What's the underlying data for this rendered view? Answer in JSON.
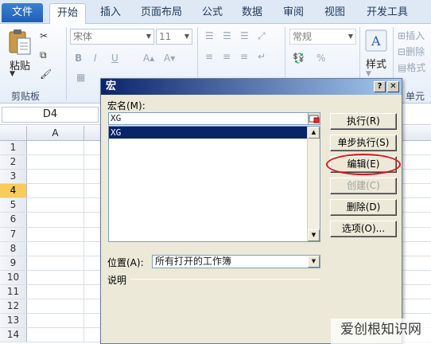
{
  "tabs": {
    "file": "文件",
    "items": [
      "开始",
      "插入",
      "页面布局",
      "公式",
      "数据",
      "审阅",
      "视图",
      "开发工具"
    ],
    "active_index": 0
  },
  "ribbon": {
    "paste_label": "粘贴",
    "clipboard_label": "剪贴板",
    "font_name": "宋体",
    "font_size": "11",
    "number_format": "常规",
    "style_label": "样式",
    "insert_label": "插入",
    "delete_label": "删除",
    "format_label": "格式",
    "cells_label": "单元格",
    "bold": "B",
    "italic": "I",
    "underline": "U"
  },
  "formula_bar": {
    "name_box": "D4"
  },
  "sheet": {
    "column_a": "A",
    "rows": [
      "1",
      "2",
      "3",
      "4",
      "5",
      "6",
      "7",
      "8",
      "9",
      "10",
      "11",
      "12",
      "13",
      "14"
    ],
    "selected_row": "4"
  },
  "dialog": {
    "title": "宏",
    "help_btn": "?",
    "close_btn": "✕",
    "macro_name_label": "宏名(M):",
    "macro_name_value": "XG",
    "macros": [
      "XG"
    ],
    "buttons": {
      "run": "执行(R)",
      "step_into": "单步执行(S)",
      "edit": "编辑(E)",
      "create": "创建(C)",
      "delete": "删除(D)",
      "options": "选项(O)..."
    },
    "location_label": "位置(A):",
    "location_value": "所有打开的工作簿",
    "description_label": "说明"
  },
  "accent": {
    "highlight_ring": "#e0131b",
    "selection": "#0a246a"
  },
  "watermark": "爱创根知识网"
}
